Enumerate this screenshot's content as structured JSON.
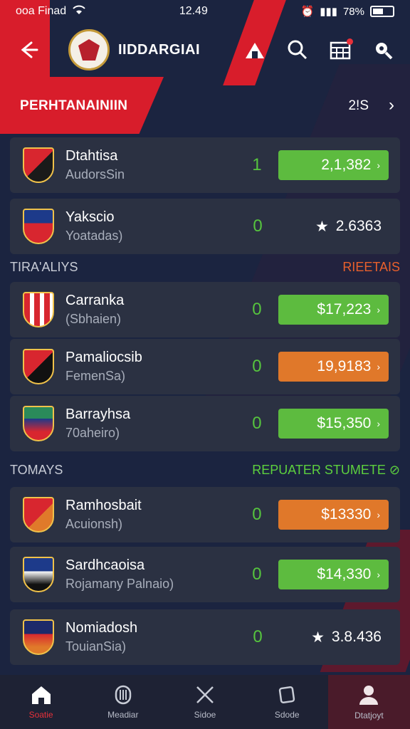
{
  "status": {
    "left_text": "ooa Finad",
    "time": "12.49",
    "battery": "78%"
  },
  "header": {
    "title": "IIDDARGIAI"
  },
  "banner": {
    "title": "PERHTANAINIIN",
    "count": "2!S"
  },
  "groups": [
    {
      "left": "TIRA'ALIYS",
      "right": "RIEETAIS"
    },
    {
      "left": "TOMAYS",
      "right": "REPUATER STUMETE ⊘"
    }
  ],
  "matches": [
    {
      "name": "Dtahtisa",
      "sub": "AudorsSin",
      "score": "1",
      "kind": "button",
      "value": "2,1,382",
      "color": "green"
    },
    {
      "name": "Yakscio",
      "sub": "Yoatadas)",
      "score": "0",
      "kind": "rating",
      "value": "2.6363"
    },
    {
      "name": "Carranka",
      "sub": "(Sbhaien)",
      "score": "0",
      "kind": "button",
      "value": "$17,223",
      "color": "green"
    },
    {
      "name": "Pamaliocsib",
      "sub": "FemenSa)",
      "score": "0",
      "kind": "button",
      "value": "19,9183",
      "color": "orange"
    },
    {
      "name": "Barrayhsa",
      "sub": "70aheiro)",
      "score": "0",
      "kind": "button",
      "value": "$15,350",
      "color": "green"
    },
    {
      "name": "Ramhosbait",
      "sub": "Acuionsh)",
      "score": "0",
      "kind": "button",
      "value": "$13330",
      "color": "orange"
    },
    {
      "name": "Sardhcaoisa",
      "sub": "Rojamany Palnaio)",
      "score": "0",
      "kind": "button",
      "value": "$14,330",
      "color": "green"
    },
    {
      "name": "Nomiadosh",
      "sub": "TouianSia)",
      "score": "0",
      "kind": "rating",
      "value": "3.8.436"
    }
  ],
  "tabs": [
    {
      "label": "Soatie",
      "icon": "home-icon"
    },
    {
      "label": "Meadiar",
      "icon": "helmet-icon"
    },
    {
      "label": "Sidoe",
      "icon": "swords-icon"
    },
    {
      "label": "Sdode",
      "icon": "card-icon"
    },
    {
      "label": "Dtatjoyt",
      "icon": "user-icon"
    }
  ]
}
